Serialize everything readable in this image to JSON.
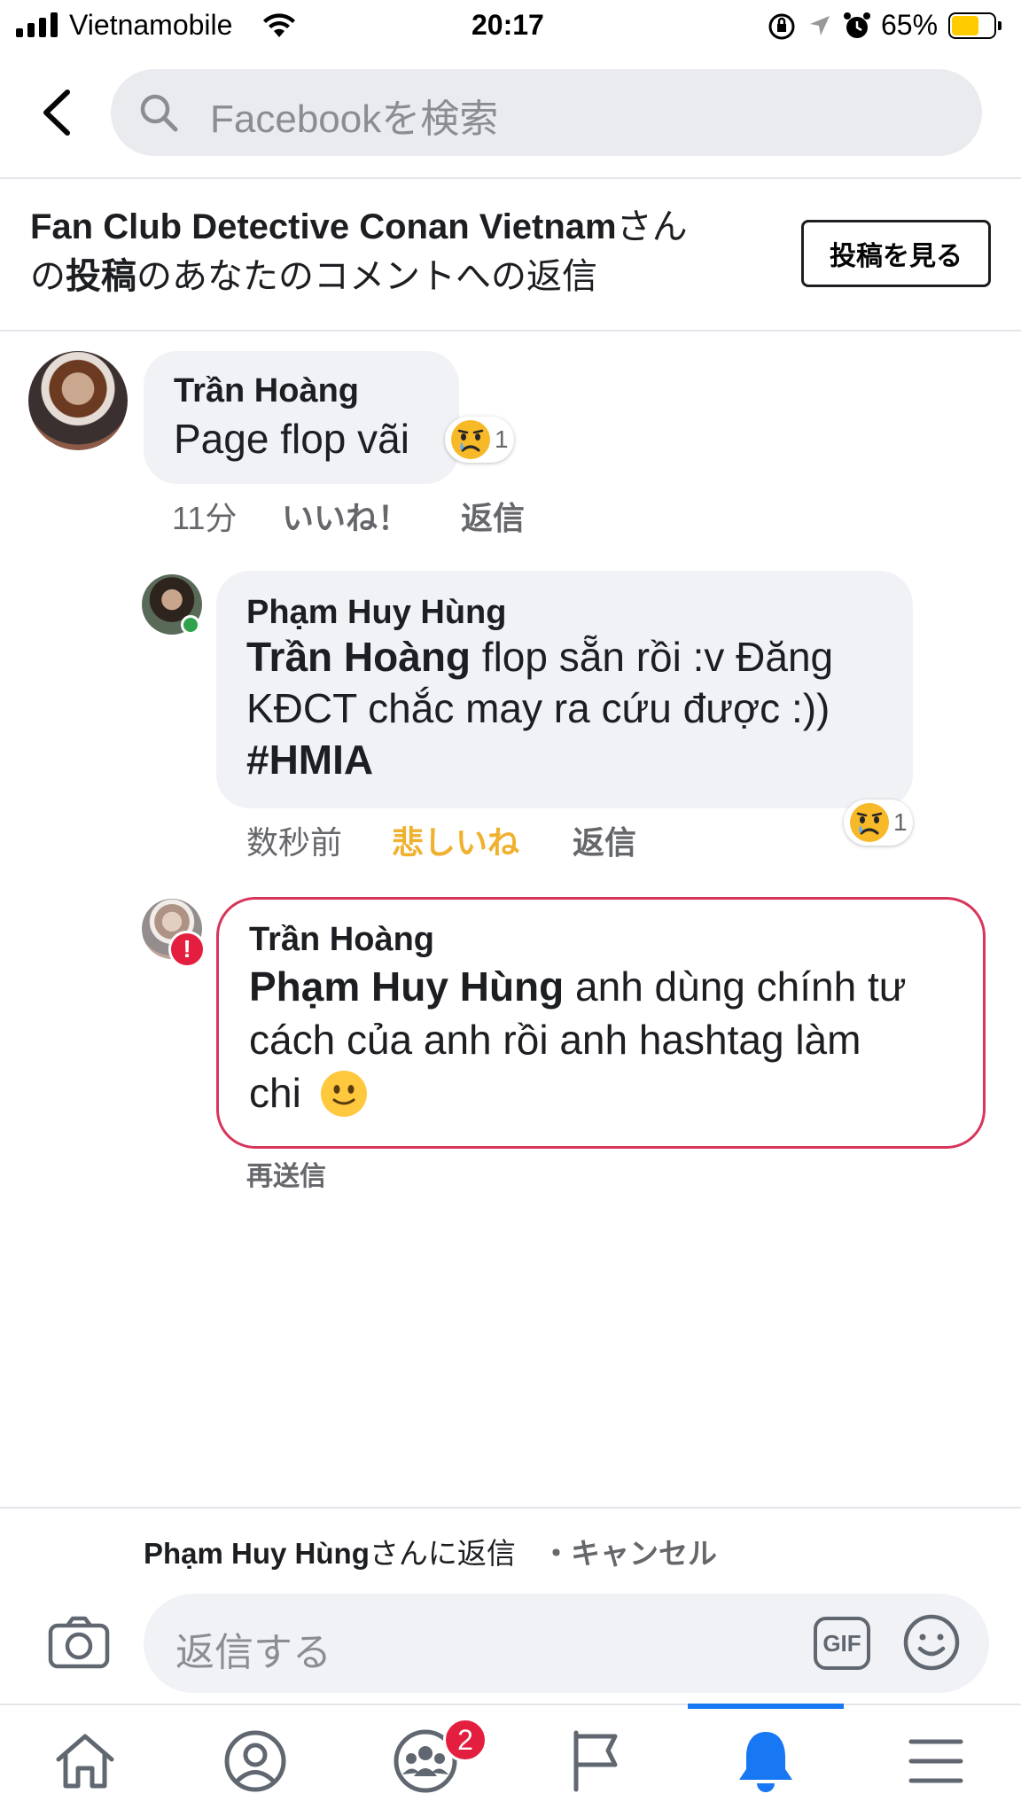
{
  "status_bar": {
    "carrier": "Vietnamobile",
    "time": "20:17",
    "battery_percent": "65%"
  },
  "search": {
    "placeholder": "Facebookを検索"
  },
  "post_info": {
    "page_name": "Fan Club Detective Conan Vietnam",
    "suffix_san": "さん",
    "no": "の",
    "post_word": "投稿",
    "rest": "のあなたのコメントへの返信",
    "view_post_button": "投稿を見る"
  },
  "comments": [
    {
      "author": "Trần Hoàng",
      "text": "Page flop vãi",
      "reaction_count": "1",
      "time": "11分",
      "like_label": "いいね！",
      "reply_label": "返信"
    },
    {
      "author": "Phạm Huy Hùng",
      "mention": "Trần Hoàng",
      "text_line1": " flop sẵn rồi :v Đăng",
      "text_line2": "KĐCT chắc may ra cứu được :))",
      "hashtag": "#HMIA",
      "reaction_count": "1",
      "time": "数秒前",
      "sad_label": "悲しいね",
      "reply_label": "返信"
    },
    {
      "author": "Trần Hoàng",
      "mention": "Phạm Huy Hùng",
      "text_line1": " anh dùng chính tư",
      "text_line2": "cách của anh rồi anh hashtag làm",
      "text_line3": "chi",
      "resend_label": "再送信"
    }
  ],
  "reply_bar": {
    "replying_to": "Phạm Huy Hùng",
    "replying_suffix": "さんに返信",
    "cancel_label": "・キャンセル",
    "input_placeholder": "返信する",
    "gif_label": "GIF"
  },
  "tabs": {
    "groups_badge": "2"
  },
  "colors": {
    "facebook_blue": "#1877f2",
    "sad_reaction_yellow": "#f7b928",
    "error_red": "#e41e3f",
    "failed_border": "#d8355a"
  }
}
